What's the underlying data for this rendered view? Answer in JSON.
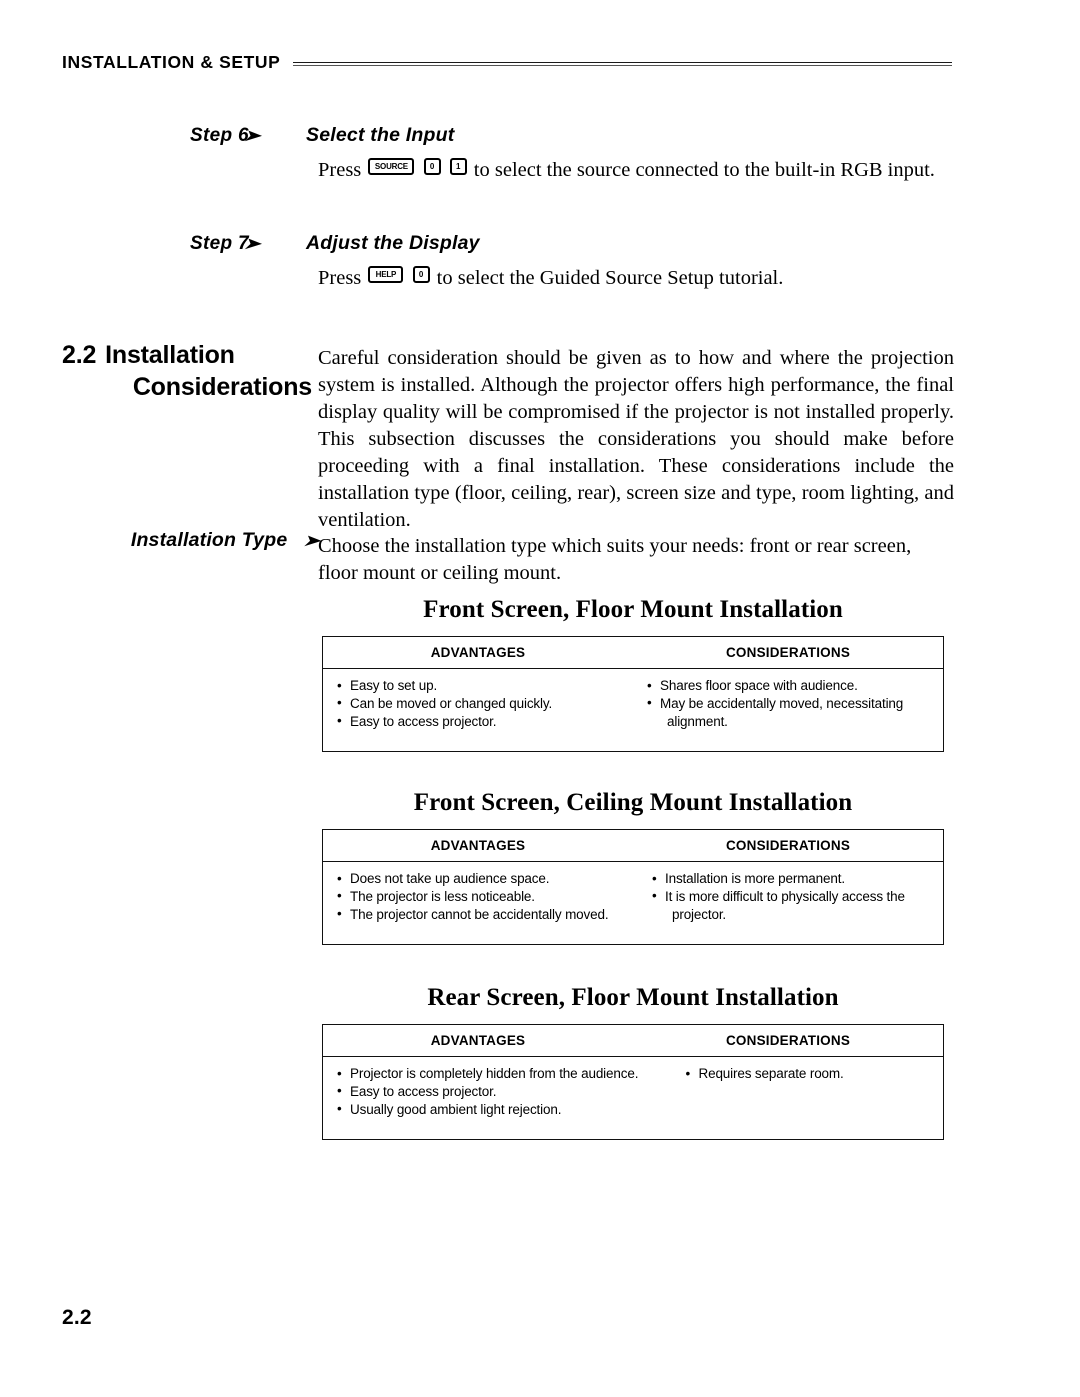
{
  "header": {
    "title": "INSTALLATION & SETUP"
  },
  "steps": [
    {
      "label": "Step 6",
      "arrow": "➤",
      "title": "Select the Input",
      "body_before": "Press",
      "keys": [
        "SOURCE",
        "0",
        "1"
      ],
      "body_after": "to select the source connected to the built-in RGB input."
    },
    {
      "label": "Step 7",
      "arrow": "➤",
      "title": "Adjust the Display",
      "body_before": "Press",
      "keys": [
        "HELP",
        "0"
      ],
      "body_after": "to select the Guided Source Setup tutorial."
    }
  ],
  "section": {
    "number": "2.2",
    "title_line1": "Installation",
    "title_line2": "Considerations",
    "body": "Careful consideration should be given as to how and where the projection system is installed. Although the projector offers high performance, the final display quality will be compromised if the projector is not installed properly. This subsection discusses the considerations you should make before proceeding with a final installation. These considerations include the installation type (floor, ceiling, rear), screen size and type, room lighting, and ventilation."
  },
  "margin_note": {
    "label": "Installation Type",
    "arrow": "➤",
    "body": "Choose the installation type which suits your needs: front or rear screen, floor mount or ceiling mount."
  },
  "install_options": [
    {
      "title": "Front Screen, Floor Mount Installation",
      "col1_header": "ADVANTAGES",
      "col2_header": "CONSIDERATIONS",
      "advantages": [
        {
          "text": "Easy to set up.",
          "cont": false
        },
        {
          "text": "Can be moved or changed quickly.",
          "cont": false
        },
        {
          "text": "Easy to access projector.",
          "cont": false
        }
      ],
      "considerations": [
        {
          "text": "Shares floor space with audience.",
          "cont": false
        },
        {
          "text": "May be accidentally moved, necessitating",
          "cont": false
        },
        {
          "text": "alignment.",
          "cont": true
        }
      ]
    },
    {
      "title": "Front Screen, Ceiling Mount Installation",
      "col1_header": "ADVANTAGES",
      "col2_header": "CONSIDERATIONS",
      "advantages": [
        {
          "text": "Does not take up audience space.",
          "cont": false
        },
        {
          "text": "The projector is less noticeable.",
          "cont": false
        },
        {
          "text": "The projector cannot be accidentally moved.",
          "cont": false
        }
      ],
      "considerations": [
        {
          "text": "Installation is more permanent.",
          "cont": false
        },
        {
          "text": "It is more difficult to physically access the",
          "cont": false
        },
        {
          "text": "projector.",
          "cont": true
        }
      ]
    },
    {
      "title": "Rear Screen, Floor Mount Installation",
      "col1_header": "ADVANTAGES",
      "col2_header": "CONSIDERATIONS",
      "advantages": [
        {
          "text": "Projector is completely hidden from the audience.",
          "cont": false
        },
        {
          "text": "Easy to access projector.",
          "cont": false
        },
        {
          "text": "Usually good ambient light rejection.",
          "cont": false
        }
      ],
      "considerations": [
        {
          "text": "Requires separate room.",
          "cont": false
        }
      ]
    }
  ],
  "footer": {
    "page_number": "2.2"
  },
  "bullet_glyph": "•"
}
